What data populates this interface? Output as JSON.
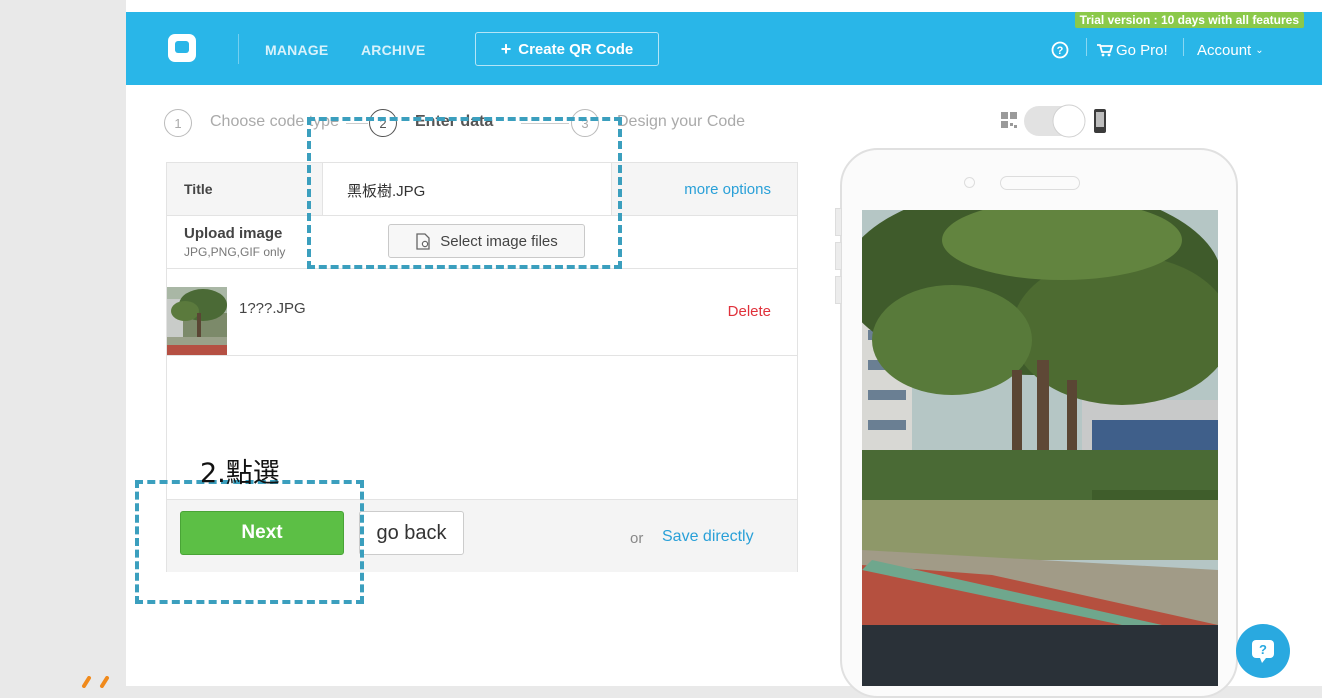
{
  "header": {
    "nav": [
      "MANAGE",
      "ARCHIVE"
    ],
    "create_button": "Create QR Code",
    "create_icon": "plus-icon",
    "trial_badge": "Trial version : 10 days with all features",
    "help_icon": "help-circle-icon",
    "go_pro": "Go Pro!",
    "account": "Account",
    "brand_color": "#29b6e8"
  },
  "steps": [
    {
      "num": "1",
      "label": "Choose code type"
    },
    {
      "num": "2",
      "label": "Enter data"
    },
    {
      "num": "3",
      "label": "Design your Code"
    }
  ],
  "form": {
    "title_label": "Title",
    "title_value": "黑板樹.JPG",
    "more_options": "more options",
    "upload_label": "Upload image",
    "upload_sub": "JPG,PNG,GIF only",
    "select_button": "Select image files",
    "file_name": "1???.JPG",
    "delete": "Delete"
  },
  "footer": {
    "next": "Next",
    "go_back": "go back",
    "or": "or",
    "save_directly": "Save directly"
  },
  "annotation": "2.點選",
  "preview": {
    "toggle_left_icon": "qr-code-icon",
    "toggle_right_icon": "phone-icon"
  }
}
